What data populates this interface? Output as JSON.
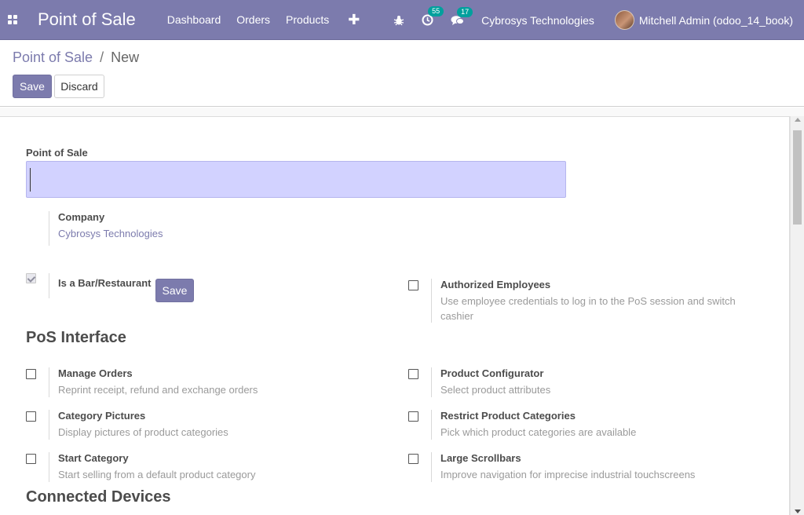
{
  "navbar": {
    "app_title": "Point of Sale",
    "menu": [
      "Dashboard",
      "Orders",
      "Products"
    ],
    "plus": "✚",
    "activity_count": "55",
    "messages_count": "17",
    "company": "Cybrosys Technologies",
    "user": "Mitchell Admin (odoo_14_book)",
    "brand_color": "#7c7bad",
    "badge_color": "#00a09d"
  },
  "breadcrumb": {
    "parent": "Point of Sale",
    "separator": "/",
    "current": "New"
  },
  "toolbar": {
    "save_label": "Save",
    "discard_label": "Discard"
  },
  "form": {
    "name_label": "Point of Sale",
    "name_value": "",
    "company": {
      "label": "Company",
      "value": "Cybrosys Technologies"
    },
    "bar_restaurant": {
      "label": "Is a Bar/Restaurant",
      "checked": true,
      "save_label": "Save"
    },
    "authorized_employees": {
      "label": "Authorized Employees",
      "description": "Use employee credentials to log in to the PoS session and switch cashier",
      "checked": false
    }
  },
  "sections": {
    "pos_interface": "PoS Interface",
    "connected_devices": "Connected Devices"
  },
  "settings": [
    {
      "title": "Manage Orders",
      "desc": "Reprint receipt, refund and exchange orders",
      "checked": false
    },
    {
      "title": "Product Configurator",
      "desc": "Select product attributes",
      "checked": false
    },
    {
      "title": "Category Pictures",
      "desc": "Display pictures of product categories",
      "checked": false
    },
    {
      "title": "Restrict Product Categories",
      "desc": "Pick which product categories are available",
      "checked": false
    },
    {
      "title": "Start Category",
      "desc": "Start selling from a default product category",
      "checked": false
    },
    {
      "title": "Large Scrollbars",
      "desc": "Improve navigation for imprecise industrial touchscreens",
      "checked": false
    }
  ]
}
